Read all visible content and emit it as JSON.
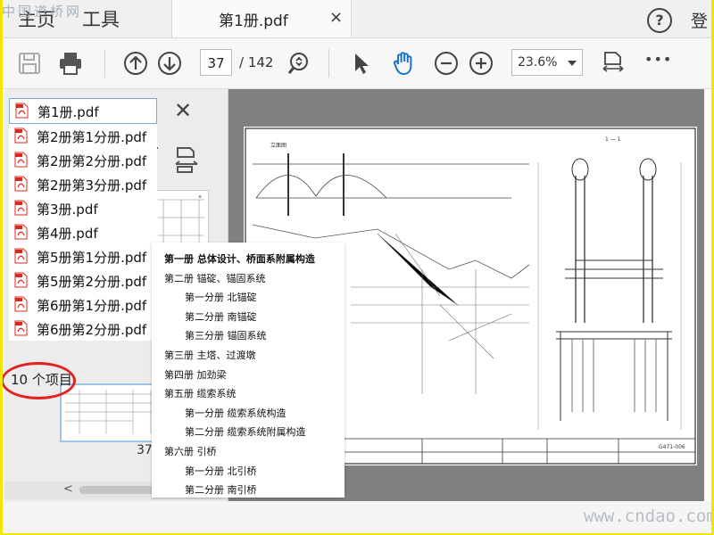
{
  "watermark_top": "中国道桥网",
  "watermark_bottom": "www.cndao.com",
  "tabbar": {
    "home": "主页",
    "tools": "工具",
    "doc_tab": "第1册.pdf",
    "close": "×",
    "help": "?",
    "signin": "登"
  },
  "toolbar": {
    "page_current": "37",
    "page_total": "/ 142",
    "zoom": "23.6%",
    "more": "•••"
  },
  "left_panel": {
    "close": "✕",
    "thumb_page_number": "37",
    "scroll_up": "˄",
    "scroll_left": "<"
  },
  "file_list": [
    "第1册.pdf",
    "第2册第1分册.pdf",
    "第2册第2分册.pdf",
    "第2册第3分册.pdf",
    "第3册.pdf",
    "第4册.pdf",
    "第5册第1分册.pdf",
    "第5册第2分册.pdf",
    "第6册第1分册.pdf",
    "第6册第2分册.pdf"
  ],
  "item_count": "10 个项目",
  "toc": [
    "第一册    总体设计、桥面系附属构造",
    "第二册    锚碇、锚固系统",
    "第一分册    北锚碇",
    "第二分册    南锚碇",
    "第三分册    锚固系统",
    "第三册    主塔、过渡墩",
    "第四册    加劲梁",
    "第五册    缆索系统",
    "第一分册    缆索系统构造",
    "第二分册    缆索系统附属构造",
    "第六册    引桥",
    "第一分册    北引桥",
    "第二分册    南引桥"
  ],
  "drawing": {
    "left_title": "立面图",
    "right_title": "1 — 1",
    "drawing_number": "G471-006"
  },
  "colors": {
    "accent_blue": "#1a73c8",
    "pdf_red": "#d9291c",
    "frame_yellow": "#f2e600",
    "highlight_red": "#e22222"
  }
}
